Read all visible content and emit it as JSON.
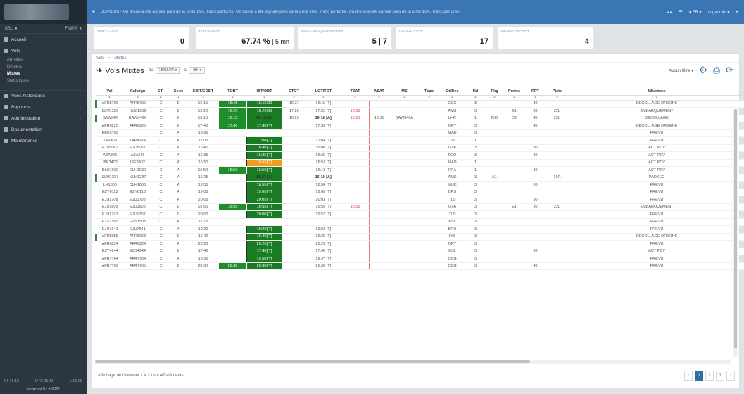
{
  "sidebar": {
    "clock_left": "BSU ●",
    "clock_right": "FMBW ●",
    "items": [
      {
        "label": "Accueil"
      },
      {
        "label": "Vols"
      },
      {
        "label": "Vues historiques"
      },
      {
        "label": "Rapports"
      },
      {
        "label": "Administration"
      },
      {
        "label": "Documentation"
      },
      {
        "label": "Maintenance"
      }
    ],
    "subitems": [
      "Arrivées",
      "Départs",
      "Mixtes",
      "Statistiques"
    ],
    "footer_left": "LT 16:15",
    "footer_mid": "UTC 16:15",
    "footer_right": "v 16.08",
    "footer_brand": "powered by ●CGM"
  },
  "topbar": {
    "ticker": "DEPOSIS - Un drone a été signalé près de la piste 10A. Trafic perturbé. Un drone a été signalé près de la piste 10A. Trafic perturbé. Un drone a été signalé près de la piste 10A. Trafic perturbé.",
    "ctrl_1": "◂ ▸",
    "ctrl_2": "☰",
    "ctrl_3": "● FR ▾",
    "user": "cdgadmin ▾",
    "bell": "●"
  },
  "kpis": [
    {
      "label": "TSAT vs ASAT",
      "value": "0",
      "sub": ""
    },
    {
      "label": "TSAT vs AOBT",
      "value": "67.74 %",
      "sub": " | 5 mn"
    },
    {
      "label": "Retard compagnie DEP / DEP",
      "value": "5 | 7",
      "sub": ""
    },
    {
      "label": "Vols avec CTOT",
      "value": "17",
      "sub": ""
    },
    {
      "label": "Vols avec CDO TOT",
      "value": "4",
      "sub": ""
    }
  ],
  "breadcrumb": [
    "Vols",
    "Mixtes"
  ],
  "toolbar": {
    "title": "Vols Mixtes",
    "label_from": "du",
    "from_value": "15/08/24 ▾",
    "label_at": "à",
    "to_value": "+8h ▾",
    "filter_dd": "Aucun filtre ▾",
    "icon_settings": "⚙",
    "icon_export": "⎙",
    "icon_refresh": "⟳"
  },
  "table": {
    "columns": [
      "Vol",
      "Callsign",
      "CP",
      "Sens",
      "EIBT/EOBT",
      "TOBT",
      "IBT/OBT",
      "CTOT",
      "LOT/TOT",
      "TSAT",
      "ASAT",
      "MS",
      "Topo",
      "Or/Des",
      "Rd",
      "Pkg",
      "Portes",
      "RPT",
      "Piste",
      "Milestone"
    ],
    "filter_mark": "▾",
    "rows": [
      {
        "vol": "AFR5700",
        "cs": "AFR5700",
        "cp": "C",
        "sens": "D",
        "eobt": "16:15",
        "tobt": "16:15",
        "obt": "16:15:00",
        "ctot": "16:27",
        "tot": "16:15 [T]",
        "tsat": "",
        "asat": "",
        "ms": "",
        "topo": "",
        "od": "CDG",
        "rd": "3",
        "pkg": "",
        "portes": "",
        "rpt": "30",
        "piste": "",
        "milestone": "DECOLLAGE ORIGINE",
        "mark": true,
        "tobtg": true,
        "obtstate": "green"
      },
      {
        "vol": "KLM1239",
        "cs": "KLM1239",
        "cp": "C",
        "sens": "D",
        "eobt": "16:20",
        "tobt": "16:20",
        "obt": "16:20:00",
        "ctot": "17:20",
        "tot": "17:02 [T]",
        "tsat": "16:58",
        "asat": "",
        "ms": "",
        "topo": "",
        "od": "AMS",
        "rd": "3",
        "pkg": "",
        "portes": "E1",
        "rpt": "30",
        "piste": "22L",
        "milestone": "EMBARQUEMENT",
        "mark": false,
        "tobtg": true,
        "obtstate": "green"
      },
      {
        "vol": "BAW346",
        "cs": "BAW346X",
        "cp": "C",
        "sens": "D",
        "eobt": "16:15",
        "tobt": "16:15",
        "obt": "16:15 [A]",
        "ctot": "16:25",
        "tot": "16:18 [A]",
        "tsat": "16:15",
        "asat": "16:15",
        "ms": "BAW346A",
        "topo": "",
        "od": "LHR",
        "rd": "1",
        "pkg": "F30",
        "portes": "D2",
        "rpt": "40",
        "piste": "22L",
        "milestone": "DECOLLAGE",
        "mark": true,
        "tobtg": true,
        "obtstate": "green",
        "bold": true
      },
      {
        "vol": "AFR6225",
        "cs": "AFR6225",
        "cp": "C",
        "sens": "D",
        "eobt": "17:40",
        "tobt": "17:40",
        "obt": "17:40 [T]",
        "ctot": "",
        "tot": "17:33 [T]",
        "tsat": "",
        "asat": "",
        "ms": "",
        "topo": "",
        "od": "ORY",
        "rd": "3",
        "pkg": "",
        "portes": "",
        "rpt": "40",
        "piste": "",
        "milestone": "DECOLLAGE ORIGINE",
        "mark": false,
        "tobtg": true,
        "obtstate": "green"
      },
      {
        "vol": "EEE3750",
        "cs": "",
        "cp": "C",
        "sens": "A",
        "eobt": "18:05",
        "tobt": "",
        "obt": "",
        "ctot": "",
        "tot": "",
        "tsat": "",
        "asat": "",
        "ms": "",
        "topo": "",
        "od": "MAD",
        "rd": "3",
        "pkg": "",
        "portes": "",
        "rpt": "",
        "piste": "",
        "milestone": "PREVU",
        "mark": false,
        "tobtg": false,
        "obtstate": "none"
      },
      {
        "vol": "TAP469",
        "cs": "TAP469A",
        "cp": "C",
        "sens": "A",
        "eobt": "17:05",
        "tobt": "",
        "obt": "17:04 [T]",
        "ctot": "",
        "tot": "17:04 [T]",
        "tsat": "",
        "asat": "",
        "ms": "",
        "topo": "",
        "od": "LIS",
        "rd": "1",
        "pkg": "",
        "portes": "",
        "rpt": "",
        "piste": "",
        "milestone": "PREVU",
        "mark": false,
        "tobtg": false,
        "obtstate": "green"
      },
      {
        "vol": "EJU5067",
        "cs": "EJU5067",
        "cp": "C",
        "sens": "A",
        "eobt": "16:40",
        "tobt": "",
        "obt": "16:40 [T]",
        "ctot": "",
        "tot": "16:40 [T]",
        "tsat": "",
        "asat": "",
        "ms": "",
        "topo": "",
        "od": "GVA",
        "rd": "3",
        "pkg": "",
        "portes": "",
        "rpt": "30",
        "piste": "",
        "milestone": "ACT PDV",
        "mark": false,
        "tobtg": false,
        "obtstate": "green"
      },
      {
        "vol": "AZA346",
        "cs": "AZA346",
        "cp": "C",
        "sens": "A",
        "eobt": "16:35",
        "tobt": "",
        "obt": "16:35 [T]",
        "ctot": "",
        "tot": "16:35 [T]",
        "tsat": "",
        "asat": "",
        "ms": "",
        "topo": "",
        "od": "FCO",
        "rd": "3",
        "pkg": "",
        "portes": "",
        "rpt": "30",
        "piste": "",
        "milestone": "ACT PDV",
        "mark": false,
        "tobtg": false,
        "obtstate": "green"
      },
      {
        "vol": "IBE3402",
        "cs": "IBE3402",
        "cp": "C",
        "sens": "A",
        "eobt": "16:50",
        "tobt": "",
        "obt": "16:53 [T]",
        "ctot": "",
        "tot": "16:53 [T]",
        "tsat": "",
        "asat": "",
        "ms": "",
        "topo": "",
        "od": "MAD",
        "rd": "1",
        "pkg": "",
        "portes": "",
        "rpt": "",
        "piste": "",
        "milestone": "ACT PDV",
        "mark": false,
        "tobtg": false,
        "obtstate": "orange"
      },
      {
        "vol": "DLH1030",
        "cs": "DLH1030",
        "cp": "C",
        "sens": "A",
        "eobt": "16:50",
        "tobt": "16:50",
        "obt": "16:50 [T]",
        "ctot": "",
        "tot": "16:13 [T]",
        "tsat": "",
        "asat": "",
        "ms": "",
        "topo": "",
        "od": "FRA",
        "rd": "1",
        "pkg": "",
        "portes": "",
        "rpt": "30",
        "piste": "",
        "milestone": "ACT PDV",
        "mark": false,
        "tobtg": true,
        "obtstate": "green"
      },
      {
        "vol": "KLM1237",
        "cs": "KLM1237",
        "cp": "C",
        "sens": "A",
        "eobt": "16:25",
        "tobt": "",
        "obt": "16:21 [A]",
        "ctot": "",
        "tot": "16:19 [A]",
        "tsat": "",
        "asat": "",
        "ms": "",
        "topo": "",
        "od": "AMS",
        "rd": "3",
        "pkg": "A1",
        "portes": "",
        "rpt": "",
        "piste": "19R",
        "milestone": "PARKED",
        "mark": true,
        "tobtg": false,
        "obtstate": "green",
        "bold": true
      },
      {
        "vol": "LH1660",
        "cs": "DLH1660",
        "cp": "C",
        "sens": "A",
        "eobt": "18:55",
        "tobt": "",
        "obt": "18:55 [T]",
        "ctot": "",
        "tot": "18:58 [T]",
        "tsat": "",
        "asat": "",
        "ms": "",
        "topo": "",
        "od": "MUC",
        "rd": "3",
        "pkg": "",
        "portes": "",
        "rpt": "30",
        "piste": "",
        "milestone": "PREVU",
        "mark": false,
        "tobtg": false,
        "obtstate": "green"
      },
      {
        "vol": "EZY6113",
        "cs": "EZY6113",
        "cp": "C",
        "sens": "A",
        "eobt": "19:05",
        "tobt": "",
        "obt": "19:05 [T]",
        "ctot": "",
        "tot": "19:05 [T]",
        "tsat": "",
        "asat": "",
        "ms": "",
        "topo": "",
        "od": "BRS",
        "rd": "3",
        "pkg": "",
        "portes": "",
        "rpt": "",
        "piste": "",
        "milestone": "PREVU",
        "mark": false,
        "tobtg": false,
        "obtstate": "green"
      },
      {
        "vol": "EJU1708",
        "cs": "EJU1708",
        "cp": "C",
        "sens": "A",
        "eobt": "20:05",
        "tobt": "",
        "obt": "20:05 [T]",
        "ctot": "",
        "tot": "20:03 [T]",
        "tsat": "",
        "asat": "",
        "ms": "",
        "topo": "",
        "od": "TLS",
        "rd": "3",
        "pkg": "",
        "portes": "",
        "rpt": "30",
        "piste": "",
        "milestone": "PREVU",
        "mark": false,
        "tobtg": false,
        "obtstate": "green"
      },
      {
        "vol": "EJU1605",
        "cs": "EJU1605",
        "cp": "C",
        "sens": "D",
        "eobt": "16:55",
        "tobt": "16:55",
        "obt": "16:55 [T]",
        "ctot": "",
        "tot": "16:55 [T]",
        "tsat": "16:55",
        "asat": "",
        "ms": "",
        "topo": "",
        "od": "GVA",
        "rd": "3",
        "pkg": "",
        "portes": "E1",
        "rpt": "30",
        "piste": "22L",
        "milestone": "EMBARQUEMENT",
        "mark": false,
        "tobtg": true,
        "obtstate": "green"
      },
      {
        "vol": "EJU1707",
        "cs": "EJU1707",
        "cp": "C",
        "sens": "D",
        "eobt": "20:00",
        "tobt": "",
        "obt": "20:00 [T]",
        "ctot": "",
        "tot": "19:52 [T]",
        "tsat": "",
        "asat": "",
        "ms": "",
        "topo": "",
        "od": "TLS",
        "rd": "3",
        "pkg": "",
        "portes": "",
        "rpt": "",
        "piste": "",
        "milestone": "PREVU",
        "mark": false,
        "tobtg": false,
        "obtstate": "green"
      },
      {
        "vol": "EZS1503",
        "cs": "EZS1503",
        "cp": "C",
        "sens": "A",
        "eobt": "17:15",
        "tobt": "",
        "obt": "",
        "ctot": "",
        "tot": "",
        "tsat": "",
        "asat": "",
        "ms": "",
        "topo": "",
        "od": "BSL",
        "rd": "3",
        "pkg": "",
        "portes": "",
        "rpt": "",
        "piste": "",
        "milestone": "PREVU",
        "mark": false,
        "tobtg": false,
        "obtstate": "none"
      },
      {
        "vol": "EJU7641",
        "cs": "EJU7641",
        "cp": "C",
        "sens": "A",
        "eobt": "19:20",
        "tobt": "",
        "obt": "19:20 [T]",
        "ctot": "",
        "tot": "19:22 [T]",
        "tsat": "",
        "asat": "",
        "ms": "",
        "topo": "",
        "od": "BRU",
        "rd": "3",
        "pkg": "",
        "portes": "",
        "rpt": "",
        "piste": "",
        "milestone": "PREVU",
        "mark": false,
        "tobtg": false,
        "obtstate": "green"
      },
      {
        "vol": "AFR8058",
        "cs": "AFR8058",
        "cp": "C",
        "sens": "D",
        "eobt": "16:40",
        "tobt": "",
        "obt": "16:40 [T]",
        "ctot": "",
        "tot": "16:35 [T]",
        "tsat": "",
        "asat": "",
        "ms": "",
        "topo": "",
        "od": "LYS",
        "rd": "3",
        "pkg": "",
        "portes": "",
        "rpt": "",
        "piste": "",
        "milestone": "DECOLLAGE ORIGINE",
        "mark": true,
        "tobtg": false,
        "obtstate": "green"
      },
      {
        "vol": "AFR6224",
        "cs": "AFR6224",
        "cp": "C",
        "sens": "A",
        "eobt": "20:20",
        "tobt": "",
        "obt": "20:20 [T]",
        "ctot": "",
        "tot": "20:23 [T]",
        "tsat": "",
        "asat": "",
        "ms": "",
        "topo": "",
        "od": "ORY",
        "rd": "3",
        "pkg": "",
        "portes": "",
        "rpt": "",
        "piste": "",
        "milestone": "PREVU",
        "mark": false,
        "tobtg": false,
        "obtstate": "green"
      },
      {
        "vol": "EZY4944",
        "cs": "EZS4944",
        "cp": "C",
        "sens": "D",
        "eobt": "17:40",
        "tobt": "",
        "obt": "17:40 [T]",
        "ctot": "",
        "tot": "17:40 [T]",
        "tsat": "",
        "asat": "",
        "ms": "",
        "topo": "",
        "od": "BSL",
        "rd": "3",
        "pkg": "",
        "portes": "",
        "rpt": "30",
        "piste": "",
        "milestone": "ACT PDV",
        "mark": false,
        "tobtg": false,
        "obtstate": "green"
      },
      {
        "vol": "AFR7704",
        "cs": "AFR7704",
        "cp": "C",
        "sens": "A",
        "eobt": "19:50",
        "tobt": "",
        "obt": "19:50 [T]",
        "ctot": "",
        "tot": "19:47 [T]",
        "tsat": "",
        "asat": "",
        "ms": "",
        "topo": "",
        "od": "CDG",
        "rd": "3",
        "pkg": "",
        "portes": "",
        "rpt": "",
        "piste": "",
        "milestone": "PREVU",
        "mark": false,
        "tobtg": false,
        "obtstate": "green"
      },
      {
        "vol": "AFR7705",
        "cs": "AFR7705",
        "cp": "C",
        "sens": "D",
        "eobt": "20:30",
        "tobt": "20:30",
        "obt": "20:30 [T]",
        "ctot": "",
        "tot": "20:30 [T]",
        "tsat": "",
        "asat": "",
        "ms": "",
        "topo": "",
        "od": "CDG",
        "rd": "3",
        "pkg": "",
        "portes": "",
        "rpt": "40",
        "piste": "",
        "milestone": "PREVU",
        "mark": false,
        "tobtg": true,
        "obtstate": "green"
      }
    ]
  },
  "footer": {
    "info": "Affichage de l'élément 1 à 23 sur 47 éléments",
    "pages": [
      "‹",
      "1",
      "2",
      "3",
      "›"
    ],
    "active_page": "1"
  }
}
